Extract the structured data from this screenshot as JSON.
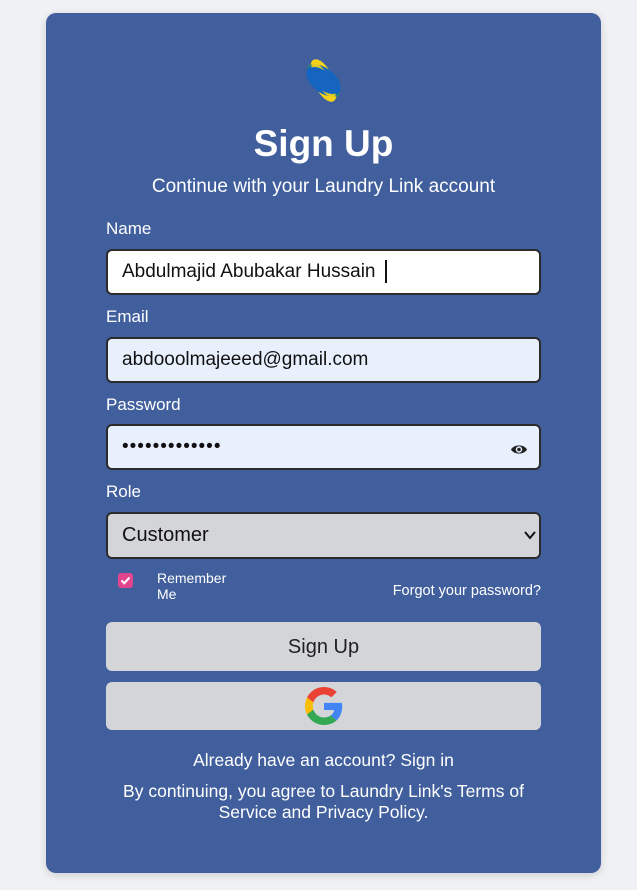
{
  "header": {
    "logo_icon": "laundry-link-logo-icon",
    "title": "Sign Up",
    "subtitle": "Continue with your Laundry Link account"
  },
  "form": {
    "name": {
      "label": "Name",
      "value": "Abdulmajid Abubakar Hussain"
    },
    "email": {
      "label": "Email",
      "value": "abdooolmajeeed@gmail.com"
    },
    "password": {
      "label": "Password",
      "value": "•••••••••••••",
      "toggle_icon": "eye-icon"
    },
    "role": {
      "label": "Role",
      "selected": "Customer",
      "icon": "chevron-down-icon"
    },
    "remember_me": {
      "label": "Remember Me",
      "checked": true
    },
    "forgot_password": "Forgot your password?",
    "signup_button": "Sign Up",
    "google_button_icon": "google-icon"
  },
  "footer": {
    "already_text": "Already have an account?",
    "sign_in_link": "Sign in",
    "terms_prefix": "By continuing, you agree to Laundry Link's",
    "terms_link": "Terms of Service",
    "and": "and",
    "privacy_link": "Privacy Policy",
    "period": "."
  },
  "colors": {
    "page_background": "#f0f1f5",
    "card_background": "#415f9d",
    "button_background": "#d4d5d9",
    "checkbox_accent": "#e0458e",
    "email_autofill_background": "#e8f0fe"
  }
}
